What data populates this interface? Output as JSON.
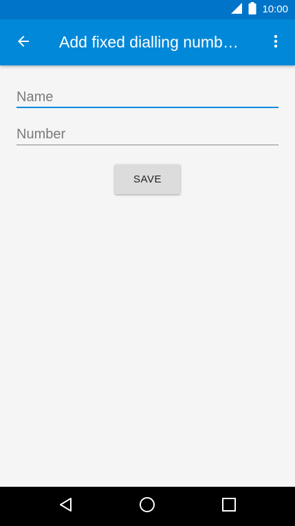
{
  "status_bar": {
    "time": "10:00",
    "icons": [
      "signal-icon",
      "battery-icon"
    ]
  },
  "app_bar": {
    "title": "Add fixed dialling numb…",
    "back_icon": "arrow-left-icon",
    "menu_icon": "more-vert-icon",
    "color": "#0288d9",
    "status_color": "#0074c8"
  },
  "form": {
    "name_placeholder": "Name",
    "name_value": "",
    "number_placeholder": "Number",
    "number_value": "",
    "save_label": "SAVE",
    "accent": "#0288d9"
  },
  "nav_bar": {
    "icons": [
      "nav-back-icon",
      "nav-home-icon",
      "nav-recents-icon"
    ]
  }
}
